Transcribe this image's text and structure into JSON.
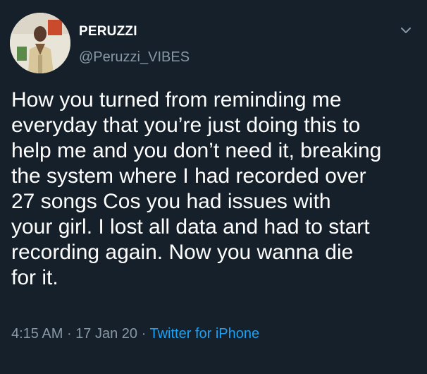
{
  "tweet": {
    "author": {
      "display_name": "PERUZZI",
      "handle": "@Peruzzi_VIBES",
      "avatar_icon": "profile-avatar"
    },
    "menu_icon": "chevron-down-icon",
    "text": "How you turned from reminding me\neveryday that you’re just doing this to\nhelp me and you don’t need it, breaking\nthe system where I had recorded over\n27 songs Cos you had issues with\nyour girl. I lost all data and had to start\nrecording again. Now you wanna die\nfor it.",
    "time": "4:15 AM",
    "separator": "·",
    "date": "17 Jan 20",
    "source": "Twitter for iPhone"
  },
  "colors": {
    "background": "#15202b",
    "text": "#ffffff",
    "muted": "#8899a6",
    "link": "#1da1f2"
  }
}
